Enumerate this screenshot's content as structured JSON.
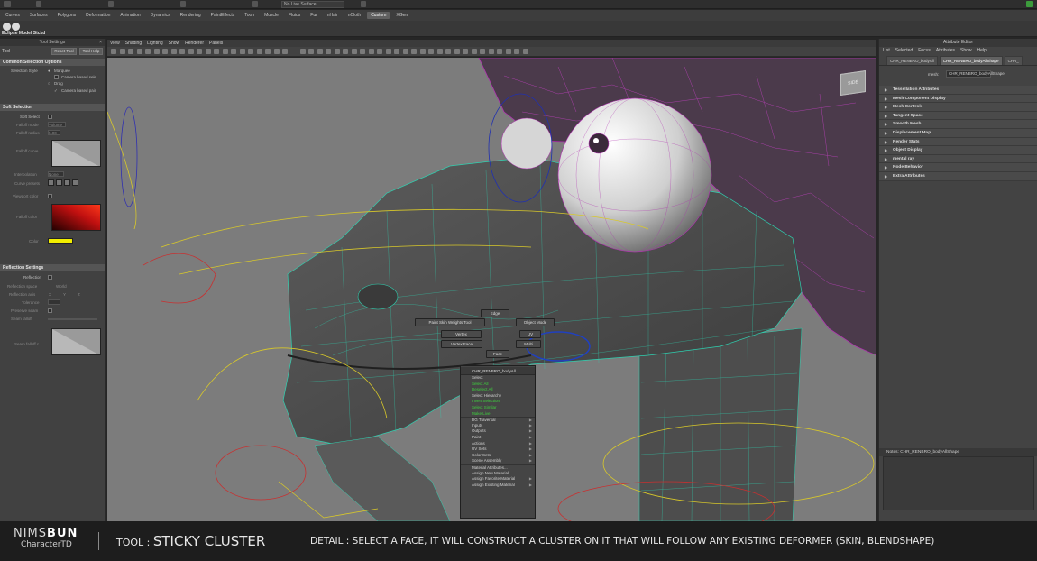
{
  "app": {
    "top_dropdown": "No Live Surface",
    "shelf_tabs": [
      "Curves",
      "Surfaces",
      "Polygons",
      "Deformation",
      "Animation",
      "Dynamics",
      "Rendering",
      "PaintEffects",
      "Toon",
      "Muscle",
      "Fluids",
      "Fur",
      "nHair",
      "nCloth",
      "Custom",
      "XGen"
    ],
    "shelf_active_tab": "Custom",
    "shelf_label": "Eclipse Model Stckd"
  },
  "tool_settings": {
    "title": "Tool Settings",
    "tool_name": "Tool",
    "reset_button": "Reset Tool",
    "help_button": "Tool Help",
    "common_header": "Common Selection Options",
    "selection_style_label": "Selection Style",
    "marquee_label": "Marquee",
    "camera_based_sel_label": "Camera based sele",
    "drag_label": "Drag",
    "camera_based_paint_label": "Camera based pain",
    "soft_header": "Soft Selection",
    "soft_select_label": "Soft Select",
    "falloff_mode_label": "Falloff mode",
    "falloff_mode_value": "Volume",
    "falloff_radius_label": "Falloff radius",
    "falloff_radius_value": "5.00",
    "falloff_curve_label": "Falloff curve",
    "interpolation_label": "Interpolation",
    "interpolation_value": "None",
    "curve_presets_label": "Curve presets",
    "viewport_color_label": "Viewport color",
    "falloff_color_label": "Falloff color",
    "color_label": "Color",
    "reflection_header": "Reflection Settings",
    "reflection_label": "Reflection",
    "reflection_space_label": "Reflection space",
    "reflection_space_value": "World",
    "reflection_axis_label": "Reflection axis",
    "reflection_axis_values": [
      "X",
      "Y",
      "Z"
    ],
    "tolerance_label": "Tolerance",
    "preserve_seam_label": "Preserve seam",
    "seam_falloff_label": "Seam falloff",
    "seam_falloff_curve_label": "Seam falloff c."
  },
  "viewport": {
    "menu": [
      "View",
      "Shading",
      "Lighting",
      "Show",
      "Renderer",
      "Panels"
    ],
    "view_cube_label": "SIDE",
    "marking_menu": {
      "edge": "Edge",
      "object_mode": "Object Mode",
      "paint_skin": "Paint Skin Weights Tool",
      "vertex": "Vertex",
      "uv": "UV",
      "vertex_face": "Vertex Face",
      "multi": "Multi",
      "face": "Face"
    },
    "context_menu": {
      "title": "CHR_RENBRO_bodyAll...",
      "items": [
        {
          "label": "Select",
          "green": false,
          "arrow": false
        },
        {
          "label": "Select All",
          "green": true,
          "arrow": false
        },
        {
          "label": "Deselect All",
          "green": true,
          "arrow": false
        },
        {
          "label": "Select Hierarchy",
          "green": false,
          "arrow": false
        },
        {
          "label": "Invert Selection",
          "green": true,
          "arrow": false
        },
        {
          "label": "Select Similar",
          "green": true,
          "arrow": false
        },
        {
          "label": "Make Live",
          "green": true,
          "arrow": false
        },
        {
          "label": "DG Traversal",
          "green": false,
          "arrow": true
        },
        {
          "label": "Inputs",
          "green": false,
          "arrow": true
        },
        {
          "label": "Outputs",
          "green": false,
          "arrow": true
        },
        {
          "label": "Paint",
          "green": false,
          "arrow": true
        },
        {
          "label": "Actions",
          "green": false,
          "arrow": true
        },
        {
          "label": "UV Sets",
          "green": false,
          "arrow": true
        },
        {
          "label": "Color Sets",
          "green": false,
          "arrow": true
        },
        {
          "label": "Scene Assembly",
          "green": false,
          "arrow": true
        },
        {
          "label": "Material Attributes...",
          "green": false,
          "arrow": false
        },
        {
          "label": "Assign New Material...",
          "green": false,
          "arrow": false
        },
        {
          "label": "Assign Favorite Material",
          "green": false,
          "arrow": true
        },
        {
          "label": "Assign Existing Material",
          "green": false,
          "arrow": true
        }
      ]
    }
  },
  "attribute_editor": {
    "title": "Attribute Editor",
    "menu": [
      "List",
      "Selected",
      "Focus",
      "Attributes",
      "Show",
      "Help"
    ],
    "tabs": [
      "CHR_RENBRO_bodyAll",
      "CHR_RENBRO_bodyAllShape",
      "CHR_"
    ],
    "active_tab_index": 1,
    "mesh_label": "mesh:",
    "mesh_value": "CHR_RENBRO_bodyAllShape",
    "sections": [
      "Tessellation Attributes",
      "Mesh Component Display",
      "Mesh Controls",
      "Tangent Space",
      "Smooth Mesh",
      "Displacement Map",
      "Render Stats",
      "Object Display",
      "mental ray",
      "Node Behavior",
      "Extra Attributes"
    ],
    "notes_label": "Notes: CHR_RENBRO_bodyAllShape"
  },
  "caption": {
    "logo_line1_a": "NIMS",
    "logo_line1_b": "BUN",
    "logo_line2": "CharacterTD",
    "tool_label": "TOOL : ",
    "tool_name": "STICKY CLUSTER",
    "detail": "DETAIL : SELECT A FACE, IT WILL CONSTRUCT A CLUSTER ON IT THAT WILL FOLLOW ANY EXISTING DEFORMER (SKIN, BLENDSHAPE)"
  }
}
